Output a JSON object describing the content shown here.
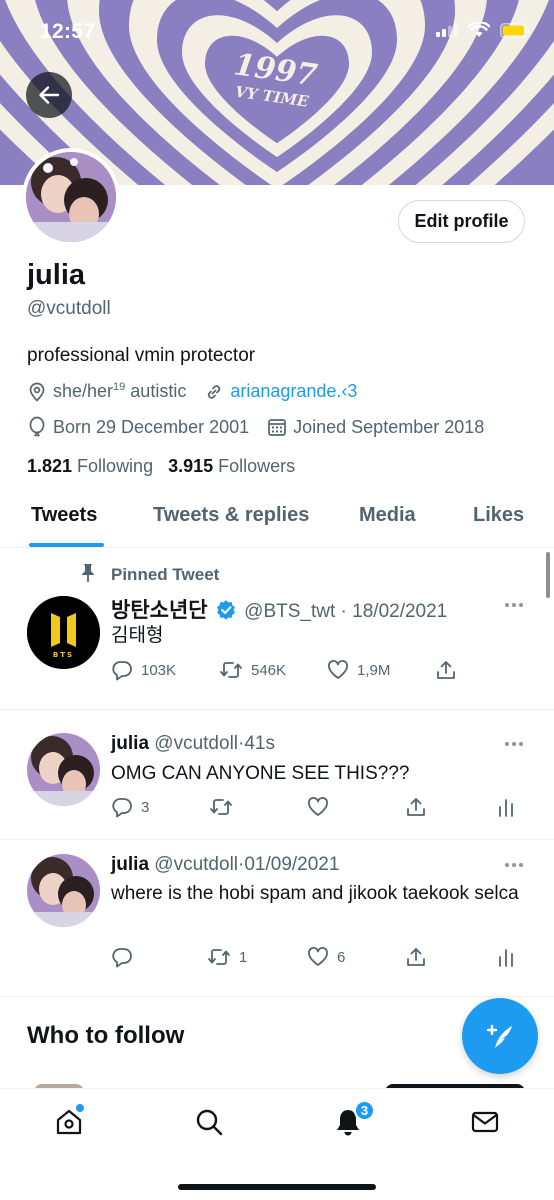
{
  "status_bar": {
    "time": "12:57"
  },
  "banner": {
    "text_line1": "1997",
    "text_line2": "VY TIME"
  },
  "profile": {
    "edit_label": "Edit profile",
    "display_name": "julia",
    "handle": "@vcutdoll",
    "bio": "professional vmin protector",
    "location_prefix": "she/her",
    "location_sup": "19",
    "location_suffix": " autistic",
    "website": "arianagrande.‹3",
    "born": "Born 29 December 2001",
    "joined": "Joined September 2018",
    "following_count": "1.821",
    "following_label": " Following",
    "followers_count": "3.915",
    "followers_label": " Followers"
  },
  "tabs": [
    "Tweets",
    "Tweets & replies",
    "Media",
    "Likes"
  ],
  "pinned_tweet": {
    "pinned_label": "Pinned Tweet",
    "name": "방탄소년단",
    "handle": "@BTS_twt",
    "date": "18/02/2021",
    "text": "김태형",
    "replies": "103K",
    "retweets": "546K",
    "likes": "1,9M",
    "avatar_text": "BTS"
  },
  "tweets": [
    {
      "name": "julia",
      "handle": "@vcutdoll",
      "time": "41s",
      "text": "OMG CAN ANYONE SEE THIS???",
      "replies": "3",
      "retweets": "",
      "likes": ""
    },
    {
      "name": "julia",
      "handle": "@vcutdoll",
      "time": "01/09/2021",
      "text": "where is the hobi spam and jikook taekook selca",
      "replies": "",
      "retweets": "1",
      "likes": "6"
    }
  ],
  "who_to_follow": "Who to follow",
  "notifications_badge": "3",
  "colors": {
    "accent": "#1d9bf0",
    "banner_purple": "#8a7fc0",
    "banner_cream": "#f4efe4"
  },
  "icons": [
    "back-arrow-icon",
    "location-icon",
    "link-icon",
    "birthday-icon",
    "calendar-icon",
    "pin-icon",
    "verified-icon",
    "reply-icon",
    "retweet-icon",
    "like-icon",
    "share-icon",
    "analytics-icon",
    "compose-icon",
    "home-icon",
    "search-icon",
    "bell-icon",
    "mail-icon"
  ]
}
